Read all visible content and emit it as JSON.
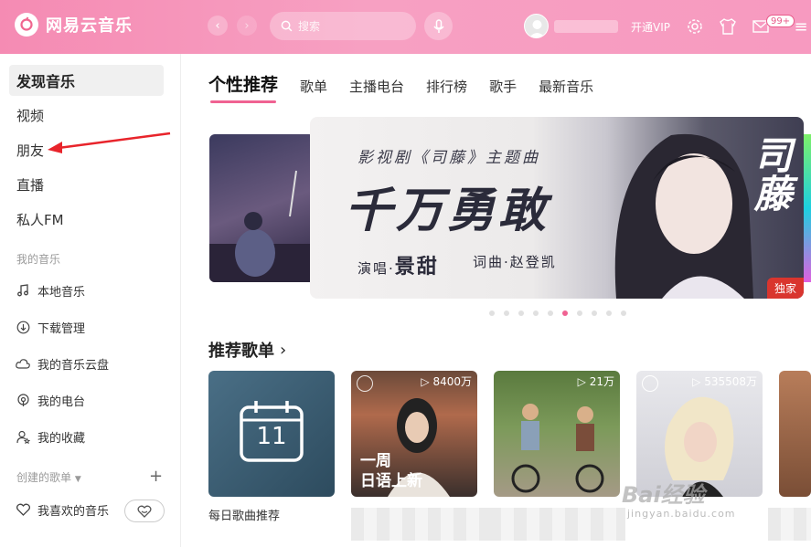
{
  "app": {
    "name": "网易云音乐"
  },
  "topbar": {
    "search_placeholder": "搜索",
    "vip_label": "开通VIP",
    "message_badge": "99+"
  },
  "sidebar": {
    "items": [
      {
        "label": "发现音乐",
        "active": true
      },
      {
        "label": "视频"
      },
      {
        "label": "朋友"
      },
      {
        "label": "直播"
      },
      {
        "label": "私人FM"
      }
    ],
    "my_music_title": "我的音乐",
    "my_music": [
      {
        "label": "本地音乐",
        "icon": "music-note-icon"
      },
      {
        "label": "下载管理",
        "icon": "download-icon"
      },
      {
        "label": "我的音乐云盘",
        "icon": "cloud-icon"
      },
      {
        "label": "我的电台",
        "icon": "radio-icon"
      },
      {
        "label": "我的收藏",
        "icon": "collection-icon"
      }
    ],
    "created_title": "创建的歌单",
    "favorite_label": "我喜欢的音乐"
  },
  "main": {
    "tabs": [
      {
        "label": "个性推荐",
        "active": true
      },
      {
        "label": "歌单"
      },
      {
        "label": "主播电台"
      },
      {
        "label": "排行榜"
      },
      {
        "label": "歌手"
      },
      {
        "label": "最新音乐"
      }
    ],
    "banner": {
      "subtitle": "影视剧《司藤》主题曲",
      "title": "千万勇敢",
      "singer_prefix": "演唱·",
      "singer": "景甜",
      "credit": "词曲·赵登凯",
      "side_title": "司藤",
      "tag": "独家",
      "dot_count": 10,
      "active_dot": 5
    },
    "section_title": "推荐歌单",
    "cards": [
      {
        "label": "每日歌曲推荐",
        "day": "11",
        "plays": ""
      },
      {
        "label": "",
        "plays": "8400万",
        "overlay": [
          "一周",
          "日语上新"
        ]
      },
      {
        "label": "",
        "plays": "21万"
      },
      {
        "label": "",
        "plays": "535508万"
      }
    ]
  },
  "watermark": {
    "brand": "Bai经验",
    "url": "jingyan.baidu.com"
  }
}
